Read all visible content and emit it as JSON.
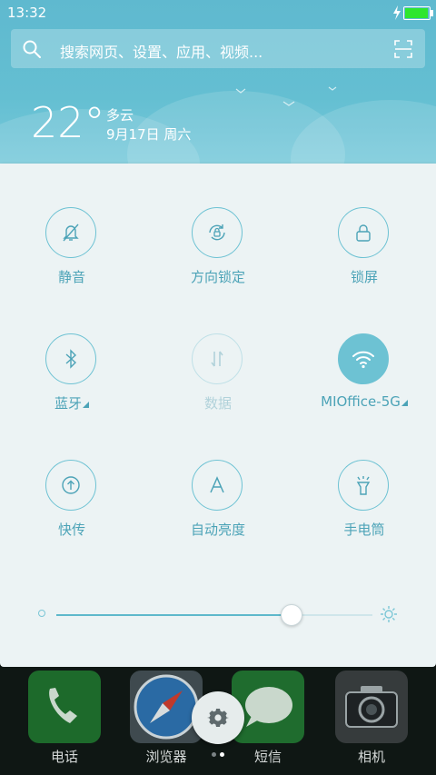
{
  "status_bar": {
    "time": "13:32",
    "battery_level": 1.0,
    "charging": true,
    "battery_color": "#2ee62e"
  },
  "search": {
    "placeholder": "搜索网页、设置、应用、视频..."
  },
  "weather": {
    "temperature": "22°",
    "condition": "多云",
    "date": "9月17日 周六"
  },
  "toggles": [
    {
      "label": "静音",
      "icon": "bell-off-icon",
      "state": "off"
    },
    {
      "label": "方向锁定",
      "icon": "rotation-lock-icon",
      "state": "off"
    },
    {
      "label": "锁屏",
      "icon": "lock-icon",
      "state": "off"
    },
    {
      "label": "蓝牙",
      "icon": "bluetooth-icon",
      "state": "off"
    },
    {
      "label": "数据",
      "icon": "mobile-data-icon",
      "state": "disabled"
    },
    {
      "label": "MIOffice-5G",
      "icon": "wifi-icon",
      "state": "on"
    },
    {
      "label": "快传",
      "icon": "quick-share-icon",
      "state": "off"
    },
    {
      "label": "自动亮度",
      "icon": "auto-brightness-icon",
      "state": "off"
    },
    {
      "label": "手电筒",
      "icon": "flashlight-icon",
      "state": "off"
    }
  ],
  "brightness": {
    "level": 0.74
  },
  "dock": {
    "apps": [
      "电话",
      "浏览器",
      "短信",
      "相机"
    ],
    "page_count": 2,
    "current_page": 1
  },
  "colors": {
    "accent": "#6dc2d3",
    "panel": "#ecf3f4",
    "header": "#5fb9cf"
  }
}
